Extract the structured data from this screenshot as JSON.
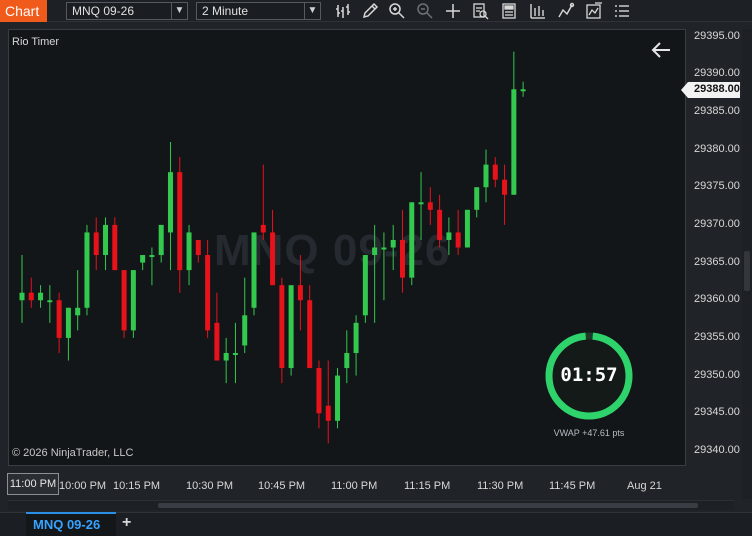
{
  "toolbar": {
    "chart_tab": "Chart",
    "instrument": "MNQ 09-26",
    "interval": "2 Minute",
    "icons": [
      "bar-type-icon",
      "draw-pencil-icon",
      "zoom-in-icon",
      "zoom-out-icon",
      "crosshair-icon",
      "data-box-icon",
      "chart-trader-icon",
      "indicators-icon",
      "strategies-icon",
      "templates-icon",
      "properties-icon"
    ]
  },
  "chart": {
    "title": "Rio Timer",
    "watermark": "MNQ 09-26",
    "copyright": "© 2026 NinjaTrader, LLC",
    "timer": "01:57",
    "timer_color": "#2fd36b",
    "vwap_text": "VWAP +47.61 pts",
    "current_price": "29388.00",
    "up_color": "#32c94e",
    "down_color": "#e8121a"
  },
  "price_axis": [
    "29395.00",
    "29390.00",
    "29385.00",
    "29380.00",
    "29375.00",
    "29370.00",
    "29365.00",
    "29360.00",
    "29355.00",
    "29350.00",
    "29345.00",
    "29340.00"
  ],
  "time_axis": {
    "badge": "11:00 PM",
    "labels": [
      "10:00 PM",
      "10:15 PM",
      "10:30 PM",
      "10:45 PM",
      "11:00 PM",
      "11:15 PM",
      "11:30 PM",
      "11:45 PM",
      "Aug 21"
    ]
  },
  "tabs": {
    "instrument_tab": "MNQ 09-26",
    "add": "+"
  },
  "chart_data": {
    "type": "candlestick",
    "interval": "2 Minute",
    "ylim": [
      29338,
      29396
    ],
    "candles": [
      {
        "o": 29360,
        "h": 29366,
        "l": 29357,
        "c": 29361
      },
      {
        "o": 29361,
        "h": 29363,
        "l": 29359,
        "c": 29360
      },
      {
        "o": 29360,
        "h": 29362,
        "l": 29359,
        "c": 29361
      },
      {
        "o": 29360,
        "h": 29362,
        "l": 29357,
        "c": 29360
      },
      {
        "o": 29360,
        "h": 29361,
        "l": 29353,
        "c": 29355
      },
      {
        "o": 29355,
        "h": 29359,
        "l": 29352,
        "c": 29359
      },
      {
        "o": 29358,
        "h": 29364,
        "l": 29356,
        "c": 29359
      },
      {
        "o": 29359,
        "h": 29370,
        "l": 29358,
        "c": 29369
      },
      {
        "o": 29369,
        "h": 29371,
        "l": 29364,
        "c": 29366
      },
      {
        "o": 29366,
        "h": 29371,
        "l": 29364,
        "c": 29370
      },
      {
        "o": 29370,
        "h": 29371,
        "l": 29364,
        "c": 29364
      },
      {
        "o": 29364,
        "h": 29364,
        "l": 29355,
        "c": 29356
      },
      {
        "o": 29356,
        "h": 29364,
        "l": 29355,
        "c": 29364
      },
      {
        "o": 29365,
        "h": 29366,
        "l": 29364,
        "c": 29366
      },
      {
        "o": 29366,
        "h": 29367,
        "l": 29362,
        "c": 29366
      },
      {
        "o": 29366,
        "h": 29370,
        "l": 29365,
        "c": 29370
      },
      {
        "o": 29369,
        "h": 29381,
        "l": 29364,
        "c": 29377
      },
      {
        "o": 29377,
        "h": 29379,
        "l": 29361,
        "c": 29364
      },
      {
        "o": 29364,
        "h": 29370,
        "l": 29362,
        "c": 29369
      },
      {
        "o": 29368,
        "h": 29368,
        "l": 29365,
        "c": 29366
      },
      {
        "o": 29366,
        "h": 29368,
        "l": 29355,
        "c": 29356
      },
      {
        "o": 29357,
        "h": 29361,
        "l": 29352,
        "c": 29352
      },
      {
        "o": 29352,
        "h": 29355,
        "l": 29349,
        "c": 29353
      },
      {
        "o": 29353,
        "h": 29357,
        "l": 29349,
        "c": 29353
      },
      {
        "o": 29354,
        "h": 29363,
        "l": 29353,
        "c": 29358
      },
      {
        "o": 29359,
        "h": 29369,
        "l": 29358,
        "c": 29369
      },
      {
        "o": 29370,
        "h": 29378,
        "l": 29368,
        "c": 29369
      },
      {
        "o": 29369,
        "h": 29372,
        "l": 29362,
        "c": 29362
      },
      {
        "o": 29362,
        "h": 29363,
        "l": 29349,
        "c": 29351
      },
      {
        "o": 29351,
        "h": 29359,
        "l": 29350,
        "c": 29362
      },
      {
        "o": 29362,
        "h": 29366,
        "l": 29356,
        "c": 29360
      },
      {
        "o": 29360,
        "h": 29362,
        "l": 29351,
        "c": 29351
      },
      {
        "o": 29351,
        "h": 29352,
        "l": 29343,
        "c": 29345
      },
      {
        "o": 29346,
        "h": 29352,
        "l": 29341,
        "c": 29344
      },
      {
        "o": 29344,
        "h": 29351,
        "l": 29343,
        "c": 29350
      },
      {
        "o": 29351,
        "h": 29356,
        "l": 29349,
        "c": 29353
      },
      {
        "o": 29353,
        "h": 29358,
        "l": 29350,
        "c": 29357
      },
      {
        "o": 29358,
        "h": 29366,
        "l": 29357,
        "c": 29366
      },
      {
        "o": 29366,
        "h": 29370,
        "l": 29357,
        "c": 29367
      },
      {
        "o": 29367,
        "h": 29369,
        "l": 29360,
        "c": 29367
      },
      {
        "o": 29367,
        "h": 29370,
        "l": 29364,
        "c": 29368
      },
      {
        "o": 29368,
        "h": 29372,
        "l": 29361,
        "c": 29363
      },
      {
        "o": 29363,
        "h": 29373,
        "l": 29362,
        "c": 29373
      },
      {
        "o": 29373,
        "h": 29377,
        "l": 29368,
        "c": 29373
      },
      {
        "o": 29373,
        "h": 29375,
        "l": 29370,
        "c": 29372
      },
      {
        "o": 29372,
        "h": 29374,
        "l": 29367,
        "c": 29368
      },
      {
        "o": 29368,
        "h": 29371,
        "l": 29366,
        "c": 29369
      },
      {
        "o": 29369,
        "h": 29372,
        "l": 29366,
        "c": 29367
      },
      {
        "o": 29367,
        "h": 29372,
        "l": 29367,
        "c": 29372
      },
      {
        "o": 29372,
        "h": 29375,
        "l": 29371,
        "c": 29375
      },
      {
        "o": 29375,
        "h": 29380,
        "l": 29373,
        "c": 29378
      },
      {
        "o": 29378,
        "h": 29379,
        "l": 29375,
        "c": 29376
      },
      {
        "o": 29376,
        "h": 29378,
        "l": 29370,
        "c": 29374
      },
      {
        "o": 29374,
        "h": 29393,
        "l": 29374,
        "c": 29388
      },
      {
        "o": 29388,
        "h": 29389,
        "l": 29387,
        "c": 29388
      }
    ]
  }
}
